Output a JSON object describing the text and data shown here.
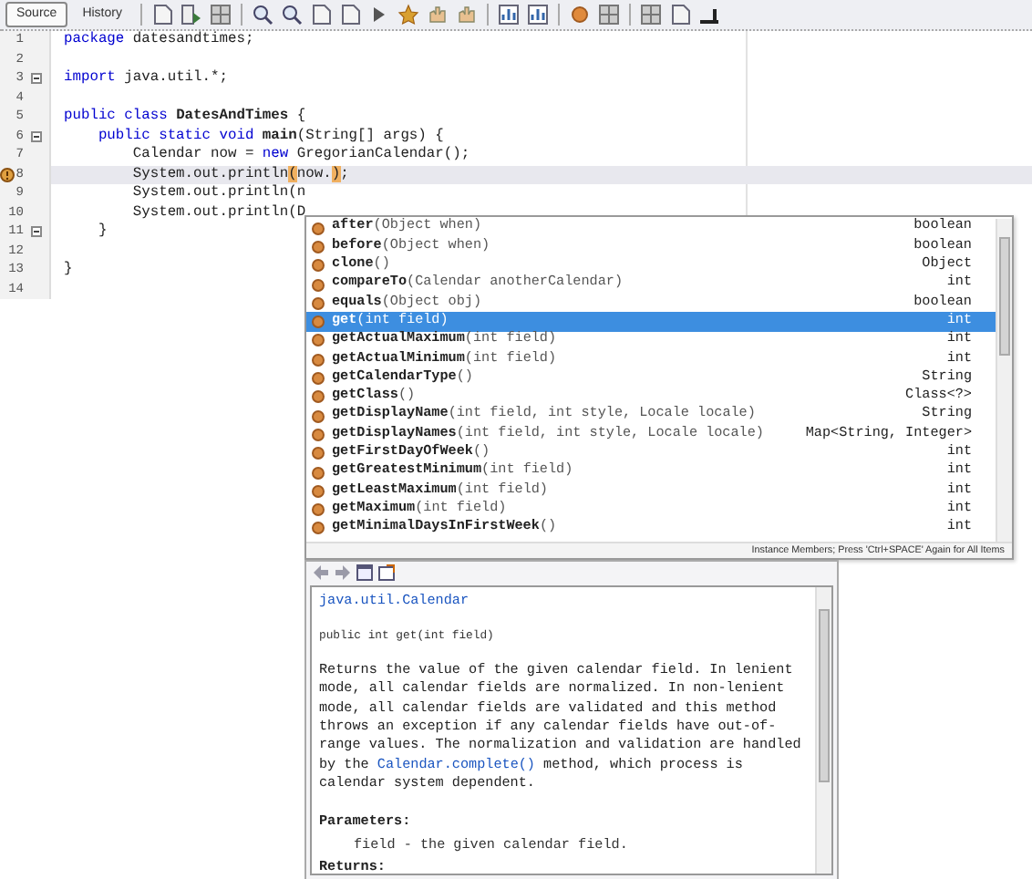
{
  "toolbar": {
    "tabs": [
      {
        "label": "Source",
        "selected": true
      },
      {
        "label": "History",
        "selected": false
      }
    ]
  },
  "editor": {
    "lines": [
      {
        "number": "1",
        "tokens": [
          {
            "text": "package",
            "kind": "keyword"
          },
          {
            "text": " datesandtimes;",
            "kind": "plain"
          }
        ]
      },
      {
        "number": "2"
      },
      {
        "number": "3",
        "fold": true,
        "tokens": [
          {
            "text": "import",
            "kind": "keyword"
          },
          {
            "text": " java.util.*;",
            "kind": "plain"
          }
        ]
      },
      {
        "number": "4"
      },
      {
        "number": "5",
        "tokens": [
          {
            "text": "public class",
            "kind": "keyword"
          },
          {
            "text": " DatesAndTimes",
            "kind": "bold"
          },
          {
            "text": " {",
            "kind": "plain"
          }
        ]
      },
      {
        "number": "6",
        "fold": true,
        "tokens": [
          {
            "text": "    public static void",
            "kind": "keyword"
          },
          {
            "text": " main",
            "kind": "bold"
          },
          {
            "text": "(String[] args) {",
            "kind": "plain"
          }
        ]
      },
      {
        "number": "7",
        "tokens": [
          {
            "text": "        Calendar now = ",
            "kind": "plain"
          },
          {
            "text": "new",
            "kind": "keyword"
          },
          {
            "text": " GregorianCalendar();",
            "kind": "plain"
          }
        ]
      },
      {
        "number": "8",
        "current": true,
        "hint": true,
        "tokens": [
          {
            "text": "        System.out.println",
            "kind": "plain"
          },
          {
            "text": "(",
            "kind": "match"
          },
          {
            "text": "now.",
            "kind": "plain"
          },
          {
            "text": ")",
            "kind": "match"
          },
          {
            "text": ";",
            "kind": "plain"
          }
        ]
      },
      {
        "number": "9",
        "tokens": [
          {
            "text": "        System.out.println(n",
            "kind": "plain"
          }
        ]
      },
      {
        "number": "10",
        "tokens": [
          {
            "text": "        System.out.println(D",
            "kind": "plain"
          }
        ]
      },
      {
        "number": "11",
        "fold": true,
        "tokens": [
          {
            "text": "    }",
            "kind": "plain"
          }
        ]
      },
      {
        "number": "12"
      },
      {
        "number": "13",
        "tokens": [
          {
            "text": "}",
            "kind": "plain"
          }
        ]
      },
      {
        "number": "14"
      }
    ]
  },
  "completion": {
    "items": [
      {
        "name": "after",
        "params": "(Object when)",
        "type": "boolean",
        "selected": false
      },
      {
        "name": "before",
        "params": "(Object when)",
        "type": "boolean",
        "selected": false
      },
      {
        "name": "clone",
        "params": "()",
        "type": "Object",
        "selected": false
      },
      {
        "name": "compareTo",
        "params": "(Calendar anotherCalendar)",
        "type": "int",
        "selected": false
      },
      {
        "name": "equals",
        "params": "(Object obj)",
        "type": "boolean",
        "selected": false
      },
      {
        "name": "get",
        "params": "(int field)",
        "type": "int",
        "selected": true
      },
      {
        "name": "getActualMaximum",
        "params": "(int field)",
        "type": "int",
        "selected": false
      },
      {
        "name": "getActualMinimum",
        "params": "(int field)",
        "type": "int",
        "selected": false
      },
      {
        "name": "getCalendarType",
        "params": "()",
        "type": "String",
        "selected": false
      },
      {
        "name": "getClass",
        "params": "()",
        "type": "Class<?>",
        "selected": false
      },
      {
        "name": "getDisplayName",
        "params": "(int field, int style, Locale locale)",
        "type": "String",
        "selected": false
      },
      {
        "name": "getDisplayNames",
        "params": "(int field, int style, Locale locale)",
        "type": "Map<String, Integer>",
        "selected": false
      },
      {
        "name": "getFirstDayOfWeek",
        "params": "()",
        "type": "int",
        "selected": false
      },
      {
        "name": "getGreatestMinimum",
        "params": "(int field)",
        "type": "int",
        "selected": false
      },
      {
        "name": "getLeastMaximum",
        "params": "(int field)",
        "type": "int",
        "selected": false
      },
      {
        "name": "getMaximum",
        "params": "(int field)",
        "type": "int",
        "selected": false
      },
      {
        "name": "getMinimalDaysInFirstWeek",
        "params": "()",
        "type": "int",
        "selected": false
      }
    ],
    "status": "Instance Members; Press 'Ctrl+SPACE' Again for All Items"
  },
  "documentation": {
    "class_link": "java.util.Calendar",
    "signature": "public int get(int field)",
    "description_before": "Returns the value of the given calendar field. In lenient mode, all calendar fields are normalized. In non-lenient mode, all calendar fields are validated and this method throws an exception if any calendar fields have out-of-range values. The normalization and validation are handled by the ",
    "description_link": "Calendar.complete()",
    "description_after": " method, which process is calendar system dependent.",
    "parameters_heading": "Parameters:",
    "parameter": "field - the given calendar field.",
    "returns_heading": "Returns:"
  }
}
